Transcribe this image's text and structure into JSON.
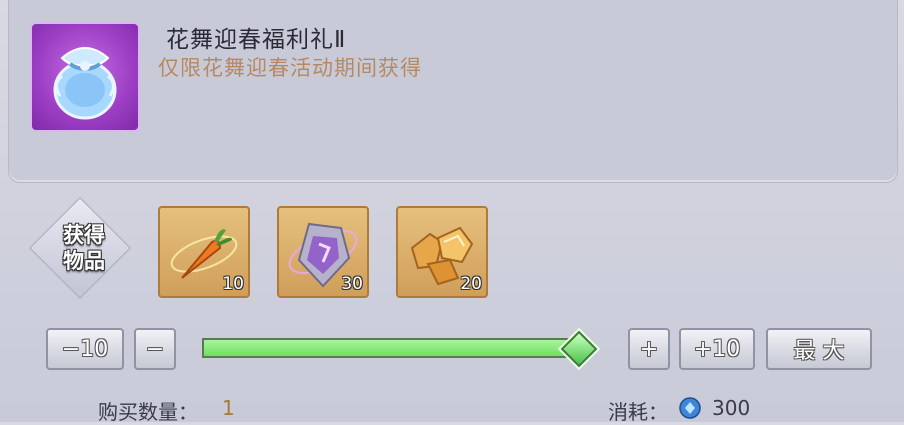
{
  "item": {
    "title": "花舞迎春福利礼Ⅱ",
    "subtitle": "仅限花舞迎春活动期间获得",
    "icon": "blue-gift-bag-icon"
  },
  "gain": {
    "label_line1": "获得",
    "label_line2": "物品"
  },
  "rewards": [
    {
      "icon": "carrot-icon",
      "count": "10"
    },
    {
      "icon": "purple-crystal-shield-icon",
      "count": "30"
    },
    {
      "icon": "gold-ore-icon",
      "count": "20"
    }
  ],
  "controls": {
    "minus_ten": "−10",
    "minus": "−",
    "plus": "+",
    "plus_ten": "+10",
    "max": "最 大",
    "slider_fill_fraction": 1.0
  },
  "purchase": {
    "quantity_label": "购买数量：",
    "quantity_value": "1",
    "cost_label": "消耗：",
    "cost_value": "300",
    "cost_icon": "diamond-gem-icon"
  },
  "colors": {
    "accent_green": "#6fde63",
    "subtitle": "#b58a63",
    "quantity": "#a07b3a"
  }
}
